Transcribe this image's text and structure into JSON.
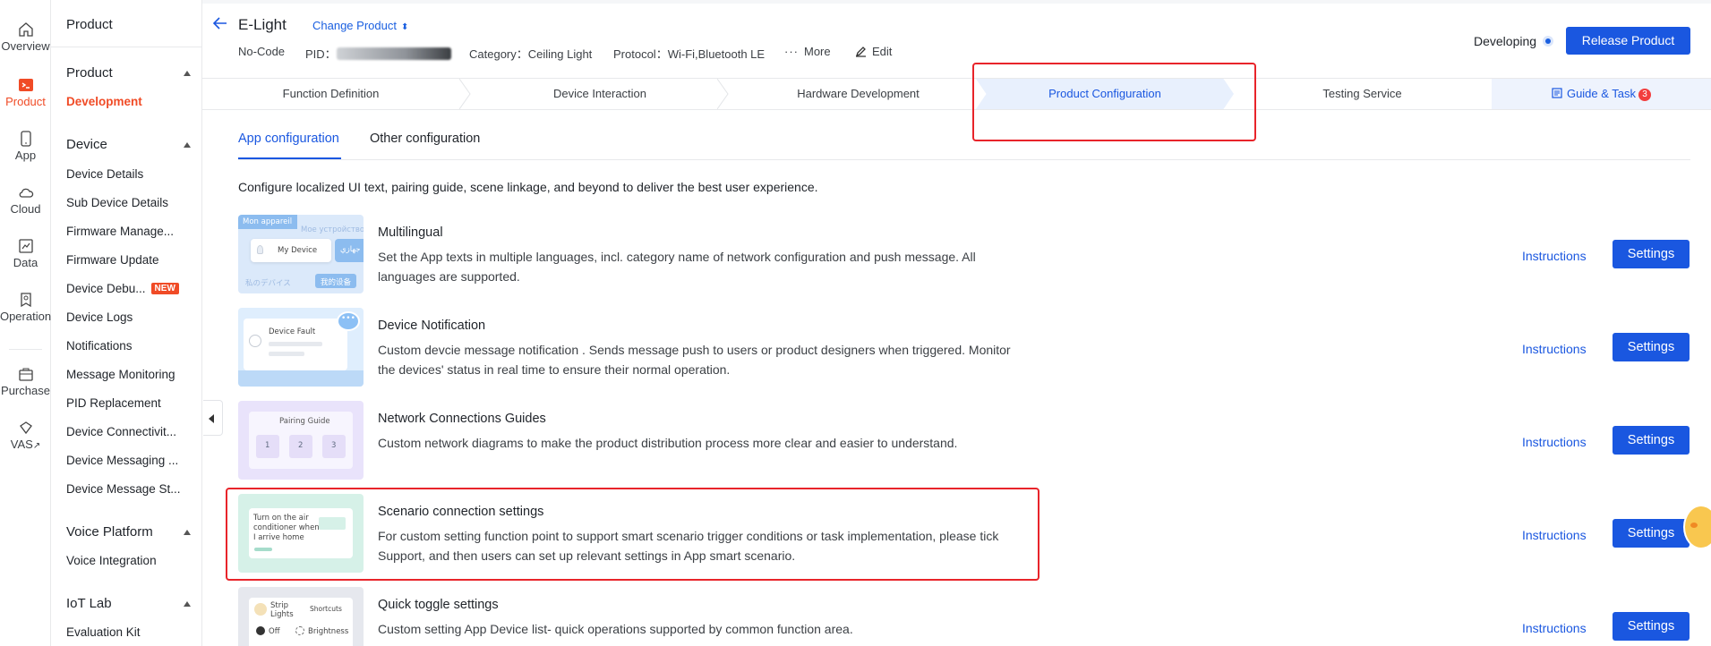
{
  "rail": {
    "items": [
      {
        "label": "Overview",
        "icon": "home-icon"
      },
      {
        "label": "Product",
        "icon": "product-icon"
      },
      {
        "label": "App",
        "icon": "phone-icon"
      },
      {
        "label": "Cloud",
        "icon": "cloud-icon"
      },
      {
        "label": "Data",
        "icon": "chart-icon"
      },
      {
        "label": "Operation",
        "icon": "operation-icon"
      },
      {
        "label": "Purchase",
        "icon": "cart-icon"
      },
      {
        "label": "VAS",
        "icon": "diamond-icon",
        "suffix": "↗"
      }
    ],
    "active_color": "#f04b26"
  },
  "subnav": {
    "title": "Product",
    "groups": [
      {
        "label": "Product",
        "items": [
          "Development"
        ]
      },
      {
        "label": "Device",
        "items": [
          "Device Details",
          "Sub Device Details",
          "Firmware Manage...",
          "Firmware Update",
          "Device Debu...",
          "Device Logs",
          "Notifications",
          "Message Monitoring",
          "PID Replacement",
          "Device Connectivit...",
          "Device Messaging ...",
          "Device Message St..."
        ]
      },
      {
        "label": "Voice Platform",
        "items": [
          "Voice Integration"
        ]
      },
      {
        "label": "IoT Lab",
        "items": [
          "Evaluation Kit"
        ]
      }
    ],
    "new_badge": "NEW"
  },
  "header": {
    "product_name": "E-Light",
    "change_product": "Change Product",
    "no_code": "No-Code",
    "pid_label": "PID：",
    "category_label": "Category：",
    "category_value": "Ceiling Light",
    "protocol_label": "Protocol：",
    "protocol_value": "Wi-Fi,Bluetooth LE",
    "more": "More",
    "edit": "Edit",
    "status": "Developing",
    "release": "Release Product"
  },
  "steps": [
    "Function Definition",
    "Device Interaction",
    "Hardware Development",
    "Product Configuration",
    "Testing Service"
  ],
  "guide": {
    "label": "Guide & Task",
    "count": "3"
  },
  "tabs": [
    "App configuration",
    "Other configuration"
  ],
  "intro": "Configure localized UI text, pairing guide, scene linkage, and beyond to deliver the best user experience.",
  "rows": [
    {
      "title": "Multilingual",
      "desc": "Set the App texts in multiple languages, incl. category name of network configuration and push message. All languages are supported."
    },
    {
      "title": "Device Notification",
      "desc": "Custom devcie message notification . Sends message push to users or product designers when triggered. Monitor the devices' status in real time to ensure their normal operation."
    },
    {
      "title": "Network Connections Guides",
      "desc": "Custom network diagrams to make the product distribution process more clear and easier to understand."
    },
    {
      "title": "Scenario connection settings",
      "desc": "For custom setting function point to support smart scenario trigger conditions or task implementation, please tick Support, and then users can set up relevant settings in App smart scenario."
    },
    {
      "title": "Quick toggle settings",
      "desc": "Custom setting App Device list- quick operations supported by common function area."
    }
  ],
  "row_actions": {
    "instructions": "Instructions",
    "settings": "Settings"
  },
  "thumbs": {
    "multilingual": [
      "Mon appareil",
      "Мое устройство",
      "My Device",
      "جهازي",
      "私のデバイス",
      "我的设备"
    ],
    "notification": [
      "Device Fault",
      "•••"
    ],
    "pairing": [
      "Pairing Guide",
      "1",
      "2",
      "3"
    ],
    "scenario": [
      "Turn on the air",
      "conditioner when",
      "I arrive home"
    ],
    "quick": [
      "Strip",
      "Lights",
      "Shortcuts",
      "Off",
      "Brightness"
    ]
  },
  "colors": {
    "accent": "#1a57e0",
    "highlight": "#e8242a"
  }
}
